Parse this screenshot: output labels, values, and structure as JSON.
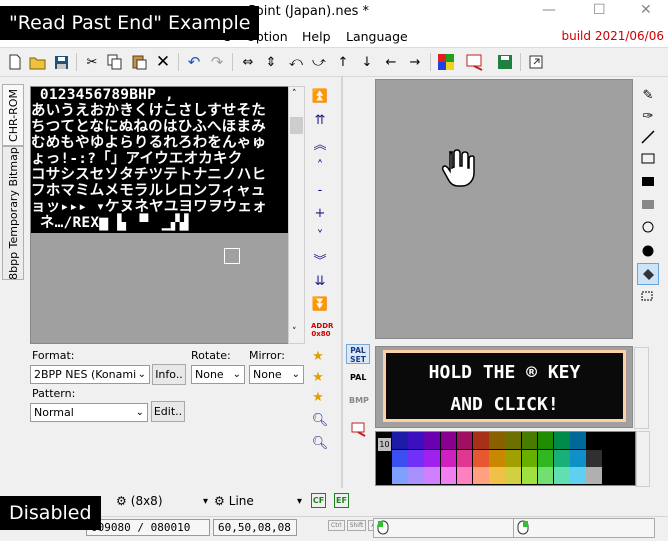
{
  "overlays": {
    "top_label": "\"Read Past End\" Example",
    "bottom_label": "Disabled"
  },
  "window": {
    "title": "ge Point (Japan).nes *",
    "minimize": "—",
    "maximize": "☐",
    "close": "✕"
  },
  "menu": {
    "items": [
      "Option",
      "Help",
      "Language"
    ],
    "partial": "e",
    "build": "build 2021/06/06"
  },
  "tabs": {
    "chr_rom": "CHR-ROM",
    "temp_bitmap": "8bpp Temporary Bitmap"
  },
  "tiles": {
    "lines": [
      " 0123456789BHP ,",
      "あいうえおかきくけこさしすせそた",
      "ちつてとなにぬねのはひふへほまみ",
      "むめもやゆよらりるれろわをんゃゅ",
      "ょっ!-:?「」アイウエオカキク",
      "コサシスセソタチツテトナニノハヒ",
      "フホマミムメモラルレロンフィャュ",
      "ョッ▸▸▸ ▾ケヌネヤユヨワヲウェォ",
      " ネ…/REX▆ ▙ ▝▘ ▁▞▟"
    ]
  },
  "form": {
    "format_label": "Format:",
    "format_value": "2BPP NES (Konami",
    "info_button": "Info..",
    "rotate_label": "Rotate:",
    "rotate_value": "None",
    "mirror_label": "Mirror:",
    "mirror_value": "None",
    "pattern_label": "Pattern:",
    "pattern_value": "Normal",
    "edit_button": "Edit.."
  },
  "side_buttons": {
    "addr": "ADDR",
    "addr_sub": "0x80"
  },
  "preview_buttons": {
    "palset": "PAL SET",
    "pal": "PAL",
    "bmp": "BMP"
  },
  "preview": {
    "line1": "HOLD THE ® KEY",
    "line2": "AND CLICK!"
  },
  "palette": {
    "index_label": "10",
    "colors": [
      "#1c1ca8",
      "#3c10c0",
      "#6800b0",
      "#880090",
      "#a01060",
      "#a83018",
      "#886000",
      "#6c7000",
      "#487c00",
      "#208c00",
      "#008c48",
      "#006898",
      "#000000",
      "#000000",
      "#3c50f0",
      "#7030f8",
      "#a020f0",
      "#d020c0",
      "#e03890",
      "#e85830",
      "#c88800",
      "#a0a000",
      "#68b000",
      "#30b820",
      "#18b078",
      "#1090c8",
      "#303030",
      "#000000",
      "#80a0ff",
      "#a890ff",
      "#d080ff",
      "#f080f0",
      "#ff80c0",
      "#ffa080",
      "#f0c048",
      "#d0d040",
      "#a0e040",
      "#70e070",
      "#60e0b0",
      "#60d0f0",
      "#b0b0b0",
      "#000000"
    ]
  },
  "bottom_toolbar": {
    "zoom": "(8x8)",
    "line_tool": "Line"
  },
  "status": {
    "address": "009080 / 080010",
    "coords": "60,50,08,08",
    "ctrl": "Ctrl",
    "shift": "Shift",
    "alt": "Alt"
  }
}
